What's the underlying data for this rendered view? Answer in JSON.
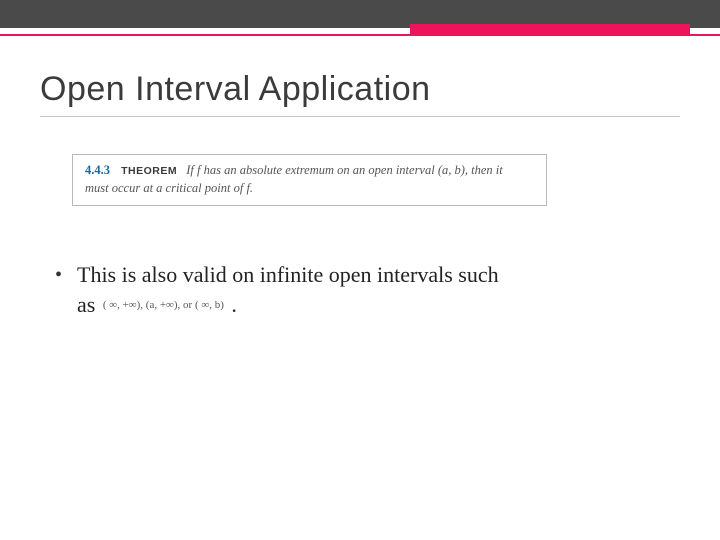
{
  "title": "Open Interval Application",
  "theorem": {
    "number": "4.4.3",
    "label": "THEOREM",
    "body_line1": "If f has an absolute extremum on an open interval (a, b), then it",
    "body_line2": "must occur at a critical point of f."
  },
  "bullet": {
    "lead": "This is also valid on infinite open intervals such",
    "continuation_prefix": "as",
    "math_intervals": "(  ∞, +∞), (a, +∞), or (  ∞, b)",
    "continuation_suffix": "."
  },
  "colors": {
    "accent_pink": "#ed145b",
    "topbar_gray": "#4a4a4a",
    "theorem_num": "#1c6aa0"
  }
}
